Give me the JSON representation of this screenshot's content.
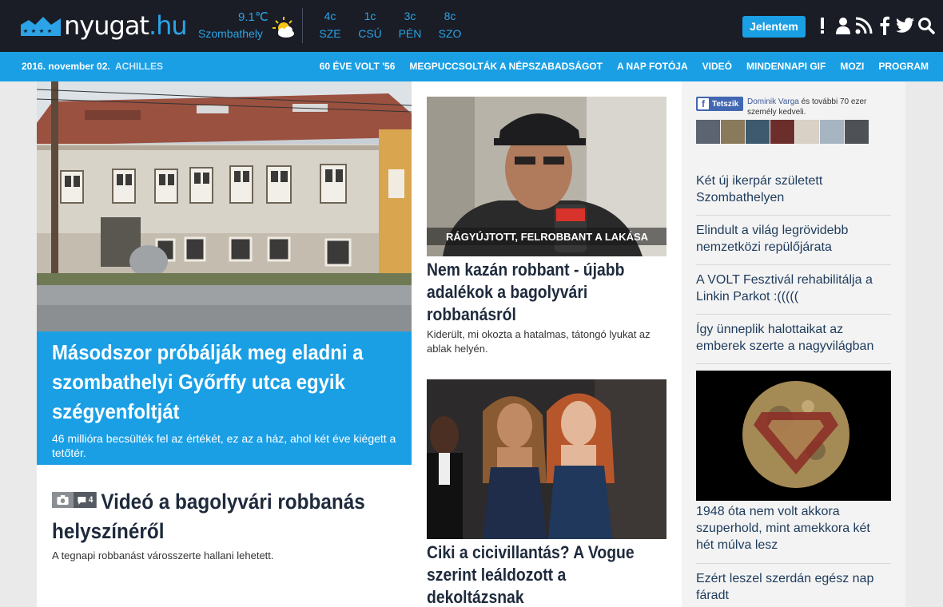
{
  "header": {
    "logo_name": "nyugat",
    "logo_tld": ".hu",
    "weather": {
      "temp_now": "9.1℃",
      "city": "Szombathely",
      "forecast": [
        {
          "temp": "4c",
          "day": "SZE"
        },
        {
          "temp": "1c",
          "day": "CSÚ"
        },
        {
          "temp": "3c",
          "day": "PÉN"
        },
        {
          "temp": "8c",
          "day": "SZO"
        }
      ]
    },
    "report_button": "Jelentem",
    "icons": [
      "alert-icon",
      "user-icon",
      "rss-icon",
      "facebook-icon",
      "twitter-icon",
      "search-icon"
    ]
  },
  "navbar": {
    "date": "2016. november 02.",
    "nameday": "ACHILLES",
    "links": [
      "60 ÉVE VOLT '56",
      "MEGPUCCSOLTÁK A NÉPSZABADSÁGOT",
      "A NAP FOTÓJA",
      "VIDEÓ",
      "MINDENNAPI GIF",
      "MOZI",
      "PROGRAM"
    ]
  },
  "main": {
    "hero": {
      "title": "Másodszor próbálják meg eladni a szombathelyi Győrffy utca egyik szégyenfoltját",
      "lead": "46 millióra becsülték fel az értékét, ez az a ház, ahol két éve kiégett a tetőtér."
    },
    "video_article": {
      "comment_count": "4",
      "title": "Videó a bagolyvári robbanás helyszínéről",
      "lead": "A tegnapi robbanást városszerte hallani lehetett."
    },
    "article2": {
      "image_caption": "RÁGYÚJTOTT, FELROBBANT A LAKÁSA",
      "title": "Nem kazán robbant - újabb adalékok a bagolyvári robbanásról",
      "lead": "Kiderült, mi okozta a hatalmas, tátongó lyukat az ablak helyén."
    },
    "article3": {
      "title": "Ciki a cicivillantás? A Vogue szerint leáldozott a dekoltázsnak"
    }
  },
  "sidebar": {
    "fb": {
      "like_label": "Tetszik",
      "friend_name": "Dominik Varga",
      "text": " és további 70 ezer személy kedveli."
    },
    "items": [
      "Két új ikerpár született Szombathelyen",
      "Elindult a világ legrövidebb nemzetközi repülőjárata",
      "A VOLT Fesztivál rehabilitálja a Linkin Parkot :(((((",
      "Így ünneplik halottaikat az emberek szerte a nagyvilágban"
    ],
    "moon_caption": "1948 óta nem volt akkora szuperhold, mint amekkora két hét múlva lesz",
    "last_item": "Ezért leszel szerdán egész nap fáradt"
  },
  "colors": {
    "header_bg": "#1a1d26",
    "accent": "#1a9fe5",
    "headline": "#1e2a3c",
    "sidebar_link": "#1e3b5c"
  }
}
